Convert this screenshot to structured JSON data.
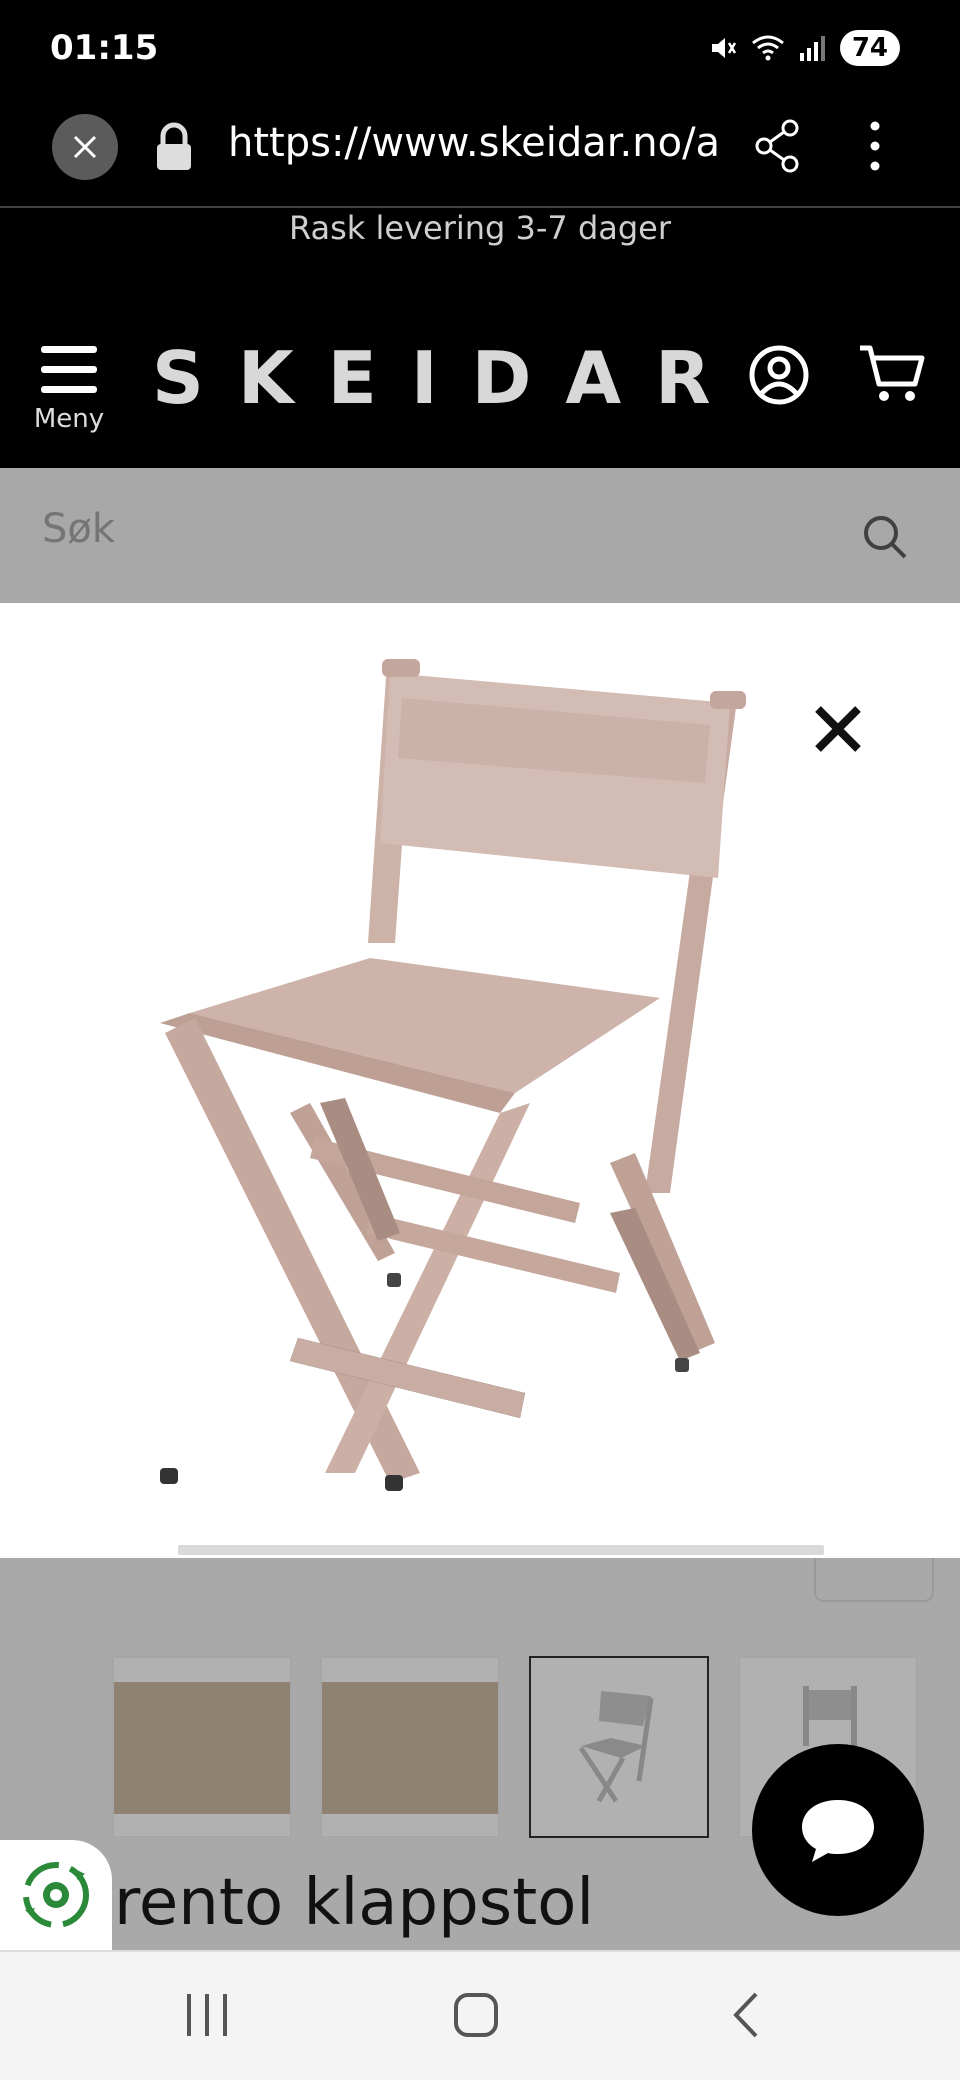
{
  "status_bar": {
    "time": "01:15",
    "battery": "74",
    "icons": [
      "mute-icon",
      "wifi-icon",
      "signal-icon",
      "battery-icon"
    ]
  },
  "browser": {
    "url": "https://www.skeidar.no/al",
    "icons": [
      "close-icon",
      "lock-icon",
      "share-icon",
      "more-icon"
    ]
  },
  "promo": {
    "text": "Rask levering 3-7 dager"
  },
  "header": {
    "menu_label": "Meny",
    "logo": "SKEIDAR",
    "icons": [
      "hamburger-icon",
      "account-icon",
      "cart-icon"
    ]
  },
  "search": {
    "placeholder": "Søk"
  },
  "viewer": {
    "image_alt": "Sorento klappstol",
    "close_icon": "close-icon"
  },
  "thumbnails": [
    {
      "kind": "lifestyle"
    },
    {
      "kind": "lifestyle"
    },
    {
      "kind": "product",
      "active": true
    },
    {
      "kind": "product"
    }
  ],
  "product": {
    "title_visible": "rento klappstol"
  },
  "colors": {
    "background_dark": "#000000",
    "overlay": "#a9a9a9",
    "chair": "#cdb2a8"
  }
}
